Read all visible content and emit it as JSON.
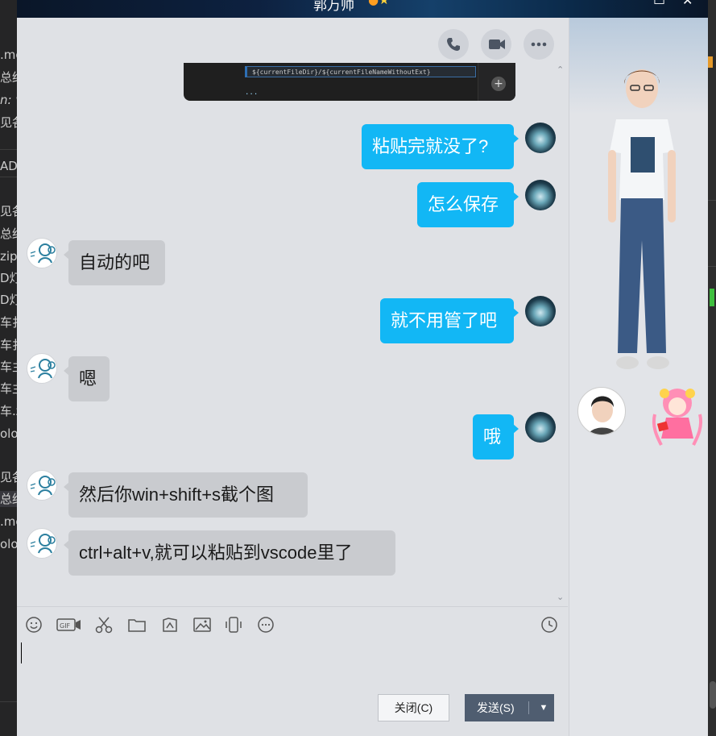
{
  "window": {
    "title": "郭万帅",
    "controls": [
      "minimize-icon",
      "close-icon"
    ]
  },
  "background_editor": {
    "lines": [
      ".mo",
      "总结",
      "n: v",
      "见各",
      "AD",
      "见各",
      "总结",
      "zip",
      "D灯",
      "D灯",
      "车扌",
      "车扌",
      "车主",
      "车主",
      "车.z",
      "olog",
      "见各",
      "总结",
      ".mo",
      "olog"
    ]
  },
  "header_actions": [
    "phone-icon",
    "video-call-icon",
    "more-icon"
  ],
  "screenshot_preview": {
    "code_line": "${currentFileDir}/${currentFileNameWithoutExt}",
    "fragment": "..."
  },
  "messages": [
    {
      "dir": "out",
      "text": "粘贴完就没了?"
    },
    {
      "dir": "out",
      "text": "怎么保存"
    },
    {
      "dir": "in",
      "text": "自动的吧"
    },
    {
      "dir": "out",
      "text": "就不用管了吧"
    },
    {
      "dir": "in",
      "text": "嗯"
    },
    {
      "dir": "out",
      "text": "哦"
    },
    {
      "dir": "in",
      "text": "然后你win+shift+s截个图"
    },
    {
      "dir": "in",
      "text": "ctrl+alt+v,就可以粘贴到vscode里了"
    }
  ],
  "toolbar": [
    "emoji-icon",
    "gif-icon",
    "screenshot-scissors-icon",
    "folder-icon",
    "image-edit-icon",
    "image-icon",
    "shake-icon",
    "more-icon",
    "history-clock-icon"
  ],
  "buttons": {
    "close_label": "关闭(C)",
    "send_label": "发送(S)"
  }
}
